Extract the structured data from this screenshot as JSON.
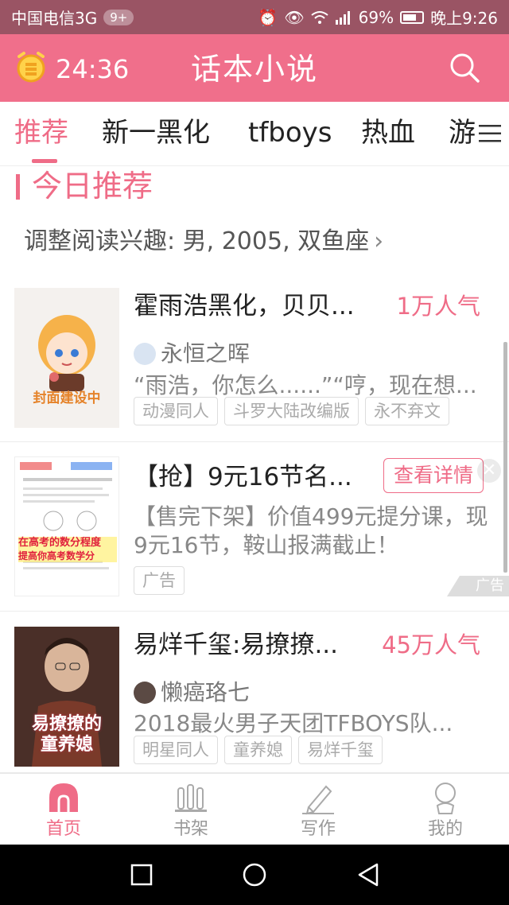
{
  "status_bar": {
    "carrier": "中国电信3G",
    "badge": "9+",
    "battery": "69%",
    "time": "晚上9:26"
  },
  "header": {
    "timer": "24:36",
    "title": "话本小说"
  },
  "tabs": [
    {
      "label": "推荐",
      "active": true
    },
    {
      "label": "新一黑化"
    },
    {
      "label": "tfboys"
    },
    {
      "label": "热血"
    },
    {
      "label": "游"
    }
  ],
  "section": {
    "title": "今日推荐",
    "interest_link": "调整阅读兴趣: 男, 2005, 双鱼座"
  },
  "books": [
    {
      "title": "霍雨浩黑化，贝贝...",
      "popularity": "1万人气",
      "author": "永恒之晖",
      "description": "“雨浩，你怎么......”“哼，现在想...",
      "tags": [
        "动漫同人",
        "斗罗大陆改编版",
        "永不弃文"
      ],
      "cover_text": "封面建设中"
    },
    {
      "title": "易烊千玺:易撩撩...",
      "popularity": "45万人气",
      "author": "懒癌珞七",
      "description": "2018最火男子天团TFBOYS队...",
      "tags": [
        "明星同人",
        "童养媳",
        "易烊千玺"
      ],
      "cover_text": [
        "易撩撩的",
        "童养媳"
      ]
    }
  ],
  "ad": {
    "title": "【抢】9元16节名...",
    "button": "查看详情",
    "description": "【售完下架】价值499元提分课，现9元16节，鞍山报满截止！",
    "tag": "广告",
    "badge": "广告",
    "cover_lines": [
      "在高考的数分程度",
      "提高你高考数学分"
    ]
  },
  "bottom_nav": [
    {
      "label": "首页",
      "icon": "home-icon",
      "active": true
    },
    {
      "label": "书架",
      "icon": "bookshelf-icon"
    },
    {
      "label": "写作",
      "icon": "pen-icon"
    },
    {
      "label": "我的",
      "icon": "profile-icon"
    }
  ],
  "colors": {
    "accent": "#ef6c87",
    "appbar": "#f06f8b",
    "statusbar": "#9a5464"
  }
}
